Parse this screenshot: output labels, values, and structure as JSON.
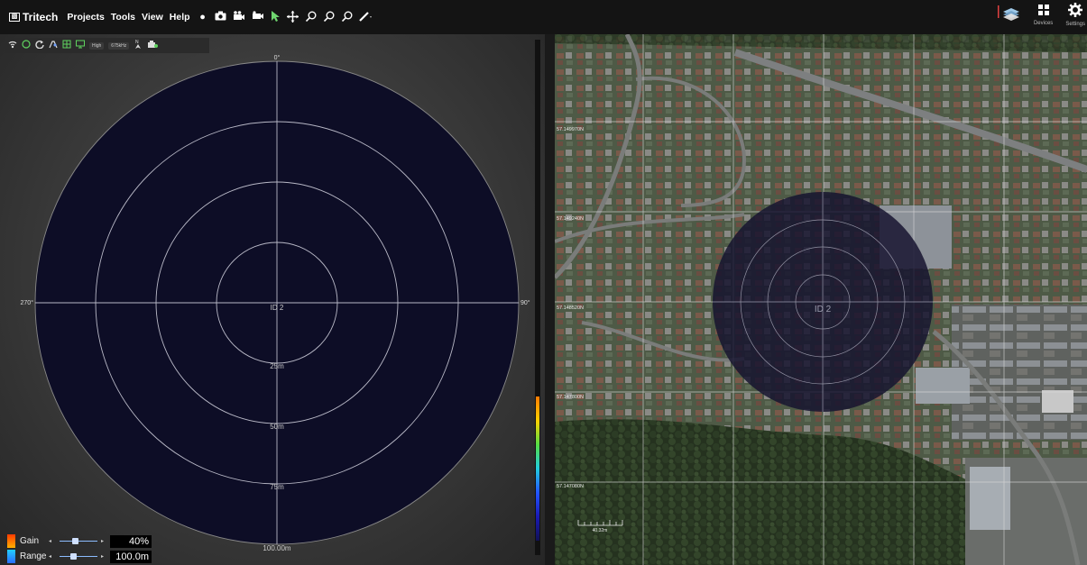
{
  "app": {
    "brand": "Tritech",
    "menu": [
      "Projects",
      "Tools",
      "View",
      "Help"
    ],
    "toolbar_icons": [
      "record-icon",
      "camera-icon",
      "video-icon",
      "video-replay-icon",
      "pointer-icon",
      "pan-icon",
      "zoom-in-icon",
      "zoom-out-icon",
      "zoom-fit-icon",
      "measure-icon"
    ],
    "right_tools": [
      {
        "icon": "layers-icon",
        "label": ""
      },
      {
        "icon": "devices-icon",
        "label": "Devices"
      },
      {
        "icon": "settings-icon",
        "label": "Settings"
      }
    ]
  },
  "sonar": {
    "toolbar": {
      "icons": [
        "signal-icon",
        "circle-icon",
        "refresh-icon",
        "palette-icon",
        "grid-icon",
        "display-icon",
        "north-icon",
        "camera-icon"
      ],
      "freq_mode": "High",
      "frequency": "675kHz"
    },
    "bearings": {
      "top": "0°",
      "left": "270°",
      "right": "90°"
    },
    "center_label": "ID 2",
    "ring_labels": [
      "25m",
      "50m",
      "75m",
      "100.00m"
    ],
    "gain": {
      "label": "Gain",
      "value": "40%",
      "level": 0.4
    },
    "range": {
      "label": "Range",
      "value": "100.0m",
      "level": 0.35
    },
    "colors": {
      "sonar_bg": "#0d0d26",
      "gain_swatch": "#ff6a00",
      "range_swatch": "#2a8cff"
    }
  },
  "map": {
    "overlay_label": "ID 2",
    "lat_labels": [
      "57.149970N",
      "57.149240N",
      "57.148520N",
      "57.147800N",
      "57.147080N"
    ],
    "scale_label": "40.32m"
  }
}
